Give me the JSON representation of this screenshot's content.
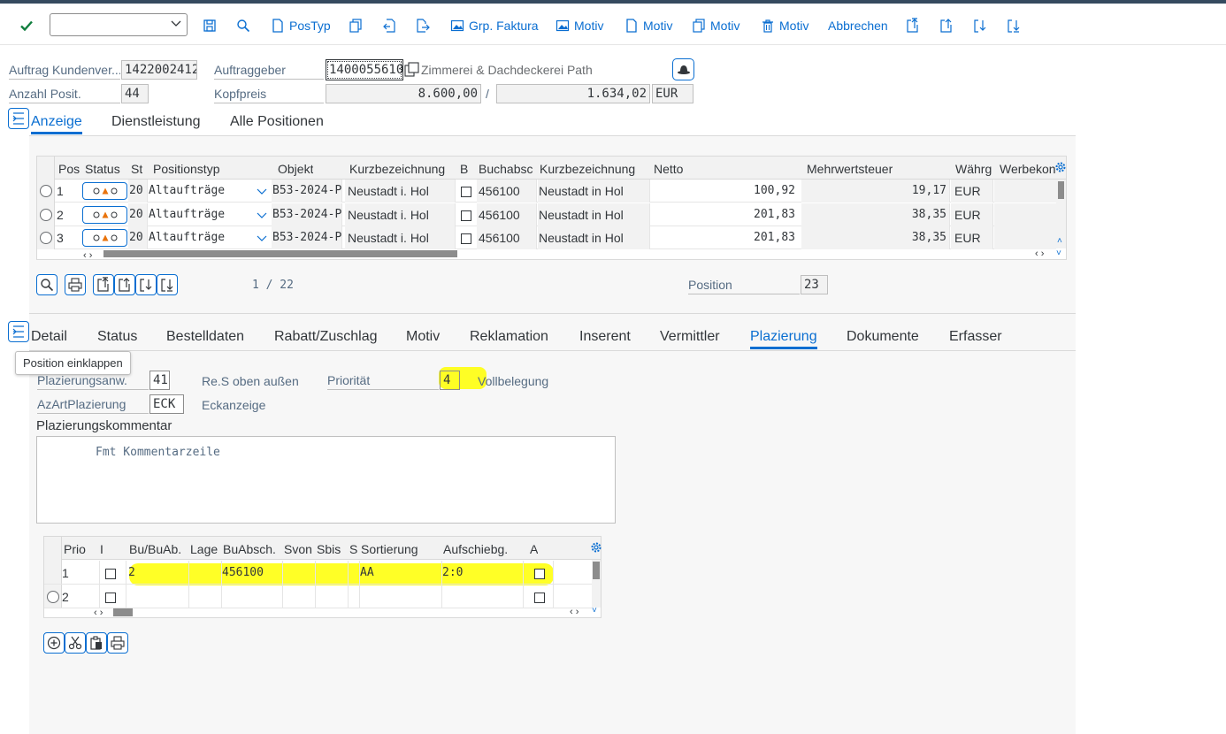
{
  "toolbar": {
    "command_field_value": "",
    "items": [
      {
        "label": "PosTyp"
      },
      {
        "label": "Grp. Faktura"
      },
      {
        "label": "Motiv"
      },
      {
        "label": "Motiv"
      },
      {
        "label": "Motiv"
      },
      {
        "label": "Motiv"
      },
      {
        "label": "Abbrechen"
      }
    ]
  },
  "header": {
    "auftrag_label": "Auftrag Kundenver...",
    "auftrag_value": "1422002412",
    "auftraggeber_label": "Auftraggeber",
    "auftraggeber_value": "1400055610",
    "auftraggeber_name": "Zimmerei & Dachdeckerei Path",
    "anzahl_label": "Anzahl Posit.",
    "anzahl_value": "44",
    "kopfpreis_label": "Kopfpreis",
    "kopfpreis_value": "8.600,00",
    "separator": "/",
    "kopfpreis_value2": "1.634,02",
    "currency": "EUR"
  },
  "top_tabs": [
    "Anzeige",
    "Dienstleistung",
    "Alle Positionen"
  ],
  "positions_table": {
    "columns": [
      "Pos",
      "Status",
      "St",
      "Positionstyp",
      "Objekt",
      "Kurzbezeichnung",
      "B",
      "Buchabsc",
      "Kurzbezeichnung",
      "Netto",
      "Mehrwertsteuer",
      "Währg",
      "Werbekon"
    ],
    "rows": [
      {
        "pos": "1",
        "st": "20",
        "typ": "Altaufträge",
        "objekt": "B53-2024-P",
        "kurz1": "Neustadt i. Hol",
        "buchabsc": "456100",
        "kurz2": "Neustadt in Hol",
        "netto": "100,92",
        "mwst": "19,17",
        "waehrg": "EUR"
      },
      {
        "pos": "2",
        "st": "20",
        "typ": "Altaufträge",
        "objekt": "B53-2024-P",
        "kurz1": "Neustadt i. Hol",
        "buchabsc": "456100",
        "kurz2": "Neustadt in Hol",
        "netto": "201,83",
        "mwst": "38,35",
        "waehrg": "EUR"
      },
      {
        "pos": "3",
        "st": "20",
        "typ": "Altaufträge",
        "objekt": "B53-2024-P",
        "kurz1": "Neustadt i. Hol",
        "buchabsc": "456100",
        "kurz2": "Neustadt in Hol",
        "netto": "201,83",
        "mwst": "38,35",
        "waehrg": "EUR"
      }
    ]
  },
  "pager": {
    "text": "1 / 22",
    "position_label": "Position",
    "position_value": "23"
  },
  "detail_tabs": [
    "Detail",
    "Status",
    "Bestelldaten",
    "Rabatt/Zuschlag",
    "Motiv",
    "Reklamation",
    "Inserent",
    "Vermittler",
    "Plazierung",
    "Dokumente",
    "Erfasser"
  ],
  "tooltip": "Position einklappen",
  "plazierung": {
    "anw_label": "Plazierungsanw.",
    "anw_value": "41",
    "anw_text": "Re.S oben außen",
    "prio_label": "Priorität",
    "prio_value": "4",
    "prio_text": "Vollbelegung",
    "azart_label": "AzArtPlazierung",
    "azart_value": "ECK",
    "azart_text": "Eckanzeige",
    "kommentar_title": "Plazierungskommentar",
    "kommentar_text": "Fmt Kommentarzeile"
  },
  "placement_table": {
    "columns": [
      "Prio",
      "I",
      "Bu/BuAb.",
      "Lage",
      "BuAbsch.",
      "Svon",
      "Sbis",
      "S",
      "Sortierung",
      "Aufschiebg.",
      "A"
    ],
    "rows": [
      {
        "prio": "1",
        "bu": "2",
        "buabsch": "456100",
        "sortierung": "AA",
        "aufschiebg": "2:0"
      },
      {
        "prio": "2",
        "bu": "",
        "buabsch": "",
        "sortierung": "",
        "aufschiebg": ""
      }
    ]
  },
  "colors": {
    "accent": "#0a6ed1",
    "highlight": "#ffff00",
    "confirm": "#107e3e"
  }
}
